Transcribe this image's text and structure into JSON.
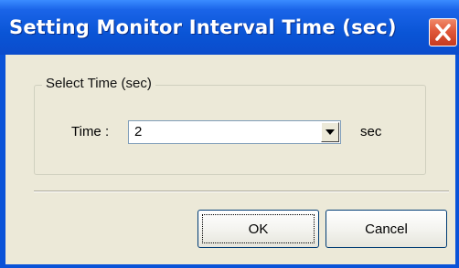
{
  "window": {
    "title": "Setting Monitor Interval Time (sec)",
    "close_icon": "close-icon"
  },
  "group": {
    "label": "Select Time (sec)"
  },
  "time_field": {
    "label": "Time :",
    "value": "2",
    "unit": "sec",
    "dropdown_icon": "chevron-down-icon"
  },
  "buttons": {
    "ok_label": "OK",
    "cancel_label": "Cancel"
  },
  "colors": {
    "titlebar": "#0a55d6",
    "dialog_background": "#ece9d8",
    "close_button": "#e0583a"
  }
}
